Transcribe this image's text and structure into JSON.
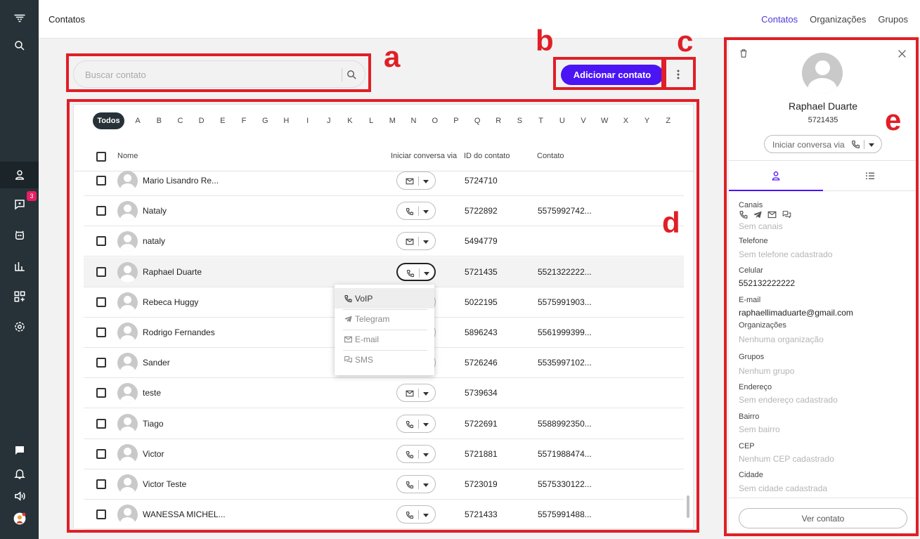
{
  "sidebar": {
    "badge": "3"
  },
  "header": {
    "title": "Contatos",
    "nav": [
      "Contatos",
      "Organizações",
      "Grupos"
    ]
  },
  "search": {
    "placeholder": "Buscar contato"
  },
  "actions": {
    "add_label": "Adicionar contato"
  },
  "annotations": {
    "a": "a",
    "b": "b",
    "c": "c",
    "d": "d",
    "e": "e"
  },
  "alphabet": {
    "all_label": "Todos",
    "letters": [
      "A",
      "B",
      "C",
      "D",
      "E",
      "F",
      "G",
      "H",
      "I",
      "J",
      "K",
      "L",
      "M",
      "N",
      "O",
      "P",
      "Q",
      "R",
      "S",
      "T",
      "U",
      "V",
      "W",
      "X",
      "Y",
      "Z"
    ]
  },
  "table": {
    "columns": {
      "name": "Nome",
      "channel": "Iniciar conversa via",
      "id": "ID do contato",
      "contact": "Contato"
    },
    "rows": [
      {
        "name": "Mario Lisandro Re...",
        "channel": "mail-icon",
        "id": "5724710",
        "contact": ""
      },
      {
        "name": "Nataly",
        "channel": "phone-icon",
        "id": "5722892",
        "contact": "5575992742..."
      },
      {
        "name": "nataly",
        "channel": "mail-icon",
        "id": "5494779",
        "contact": ""
      },
      {
        "name": "Raphael Duarte",
        "channel": "phone-icon",
        "id": "5721435",
        "contact": "5521322222..."
      },
      {
        "name": "Rebeca Huggy",
        "channel": "phone-icon",
        "id": "5022195",
        "contact": "5575991903..."
      },
      {
        "name": "Rodrigo Fernandes",
        "channel": "phone-icon",
        "id": "5896243",
        "contact": "5561999399..."
      },
      {
        "name": "Sander",
        "channel": "phone-icon",
        "id": "5726246",
        "contact": "5535997102..."
      },
      {
        "name": "teste",
        "channel": "mail-icon",
        "id": "5739634",
        "contact": ""
      },
      {
        "name": "Tiago",
        "channel": "phone-icon",
        "id": "5722691",
        "contact": "5588992350..."
      },
      {
        "name": "Victor",
        "channel": "phone-icon",
        "id": "5721881",
        "contact": "5571988474..."
      },
      {
        "name": "Victor Teste",
        "channel": "phone-icon",
        "id": "5723019",
        "contact": "5575330122..."
      },
      {
        "name": "WANESSA MICHEL...",
        "channel": "phone-icon",
        "id": "5721433",
        "contact": "5575991488..."
      }
    ]
  },
  "dropdown": {
    "items": [
      "VoIP",
      "Telegram",
      "E-mail",
      "SMS"
    ]
  },
  "detail": {
    "name": "Raphael Duarte",
    "id": "5721435",
    "start_conv": "Iniciar conversa via",
    "fields": {
      "canais_label": "Canais",
      "canais_value": "Sem canais",
      "telefone_label": "Telefone",
      "telefone_value": "Sem telefone cadastrado",
      "celular_label": "Celular",
      "celular_value": "552132222222",
      "email_label": "E-mail",
      "email_value": "raphaellimaduarte@gmail.com",
      "org_label": "Organizações",
      "org_value": "Nenhuma organização",
      "grupos_label": "Grupos",
      "grupos_value": "Nenhum grupo",
      "endereco_label": "Endereço",
      "endereco_value": "Sem endereço cadastrado",
      "bairro_label": "Bairro",
      "bairro_value": "Sem bairro",
      "cep_label": "CEP",
      "cep_value": "Nenhum CEP cadastrado",
      "cidade_label": "Cidade",
      "cidade_value": "Sem cidade cadastrada"
    },
    "view_label": "Ver contato"
  },
  "colors": {
    "accent": "#4b14f5",
    "sidebar": "#263238",
    "annotation": "#e01f26"
  }
}
